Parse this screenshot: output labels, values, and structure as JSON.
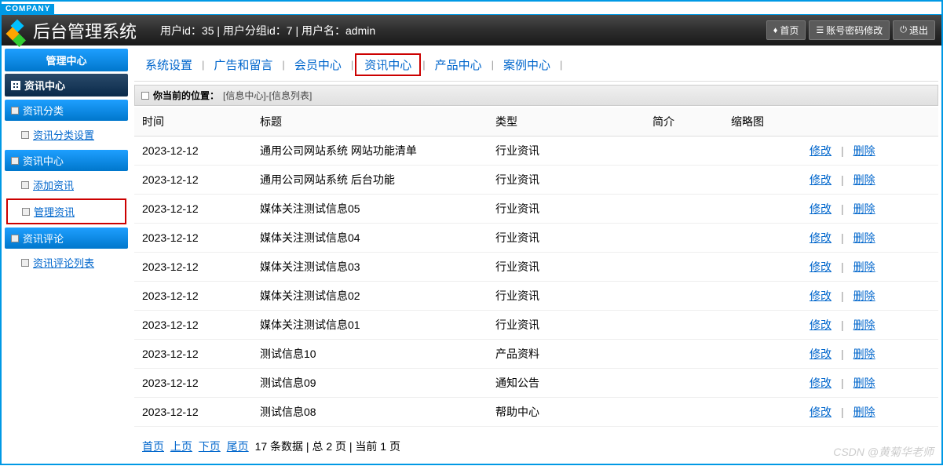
{
  "company_tag": "COMPANY",
  "header": {
    "title": "后台管理系统",
    "user_info": "用户id：35 | 用户分组id：7 | 用户名：admin",
    "actions": {
      "home": "首页",
      "password": "账号密码修改",
      "logout": "退出"
    }
  },
  "sidebar": {
    "main_header": "管理中心",
    "sub_header": "资讯中心",
    "sections": [
      {
        "title": "资讯分类",
        "items": [
          {
            "label": "资讯分类设置",
            "active": false
          }
        ]
      },
      {
        "title": "资讯中心",
        "items": [
          {
            "label": "添加资讯",
            "active": false
          },
          {
            "label": "管理资讯",
            "active": true
          }
        ]
      },
      {
        "title": "资讯评论",
        "items": [
          {
            "label": "资讯评论列表",
            "active": false
          }
        ]
      }
    ]
  },
  "tabs": [
    {
      "label": "系统设置",
      "active": false
    },
    {
      "label": "广告和留言",
      "active": false
    },
    {
      "label": "会员中心",
      "active": false
    },
    {
      "label": "资讯中心",
      "active": true
    },
    {
      "label": "产品中心",
      "active": false
    },
    {
      "label": "案例中心",
      "active": false
    }
  ],
  "breadcrumb": {
    "label": "你当前的位置：",
    "path": "[信息中心]-[信息列表]"
  },
  "table": {
    "columns": [
      "时间",
      "标题",
      "类型",
      "简介",
      "缩略图",
      ""
    ],
    "action_edit": "修改",
    "action_delete": "删除",
    "rows": [
      {
        "time": "2023-12-12",
        "title": "通用公司网站系统 网站功能清单",
        "type": "行业资讯",
        "intro": "",
        "thumb": ""
      },
      {
        "time": "2023-12-12",
        "title": "通用公司网站系统 后台功能",
        "type": "行业资讯",
        "intro": "",
        "thumb": ""
      },
      {
        "time": "2023-12-12",
        "title": "媒体关注测试信息05",
        "type": "行业资讯",
        "intro": "",
        "thumb": ""
      },
      {
        "time": "2023-12-12",
        "title": "媒体关注测试信息04",
        "type": "行业资讯",
        "intro": "",
        "thumb": ""
      },
      {
        "time": "2023-12-12",
        "title": "媒体关注测试信息03",
        "type": "行业资讯",
        "intro": "",
        "thumb": ""
      },
      {
        "time": "2023-12-12",
        "title": "媒体关注测试信息02",
        "type": "行业资讯",
        "intro": "",
        "thumb": ""
      },
      {
        "time": "2023-12-12",
        "title": "媒体关注测试信息01",
        "type": "行业资讯",
        "intro": "",
        "thumb": ""
      },
      {
        "time": "2023-12-12",
        "title": "测试信息10",
        "type": "产品资料",
        "intro": "",
        "thumb": ""
      },
      {
        "time": "2023-12-12",
        "title": "测试信息09",
        "type": "通知公告",
        "intro": "",
        "thumb": ""
      },
      {
        "time": "2023-12-12",
        "title": "测试信息08",
        "type": "帮助中心",
        "intro": "",
        "thumb": ""
      }
    ]
  },
  "pager": {
    "first": "首页",
    "prev": "上页",
    "next": "下页",
    "last": "尾页",
    "info": "17 条数据 | 总 2 页 | 当前 1 页"
  },
  "watermark": "CSDN @黄菊华老师"
}
